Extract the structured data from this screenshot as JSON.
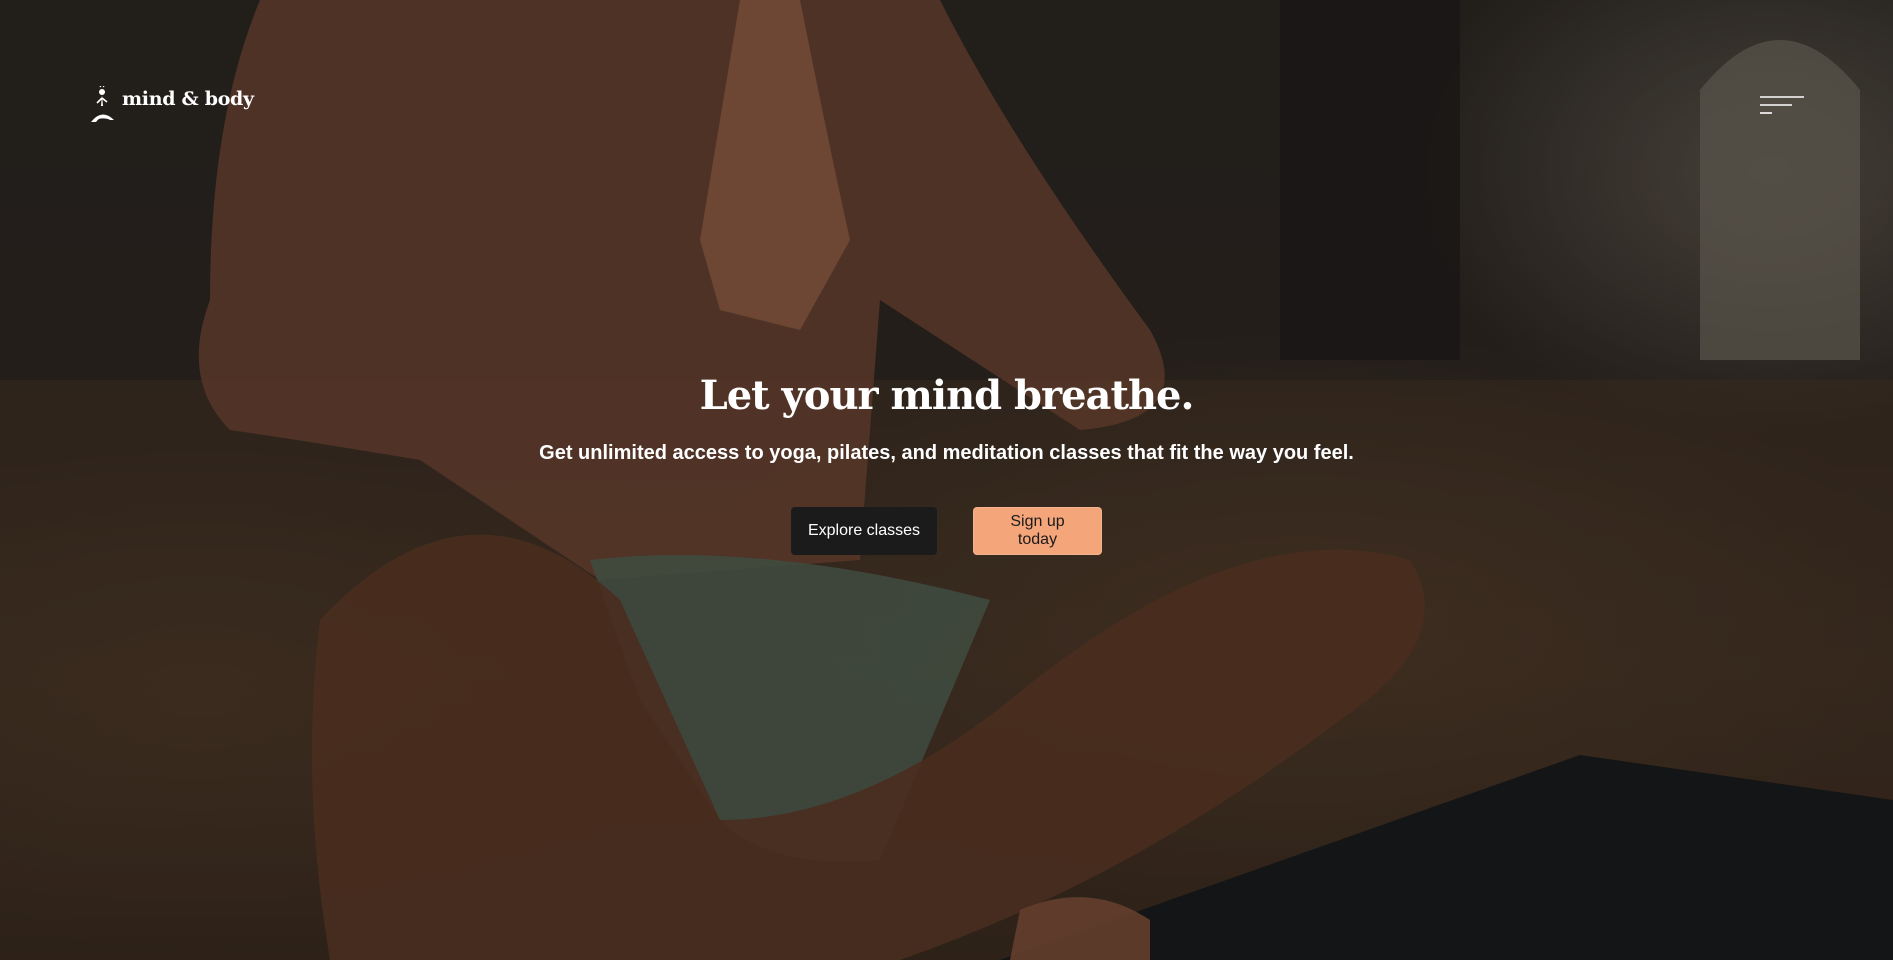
{
  "brand": {
    "logo_text": "mind & body",
    "logo_icon": "meditating-figure-icon"
  },
  "header": {
    "menu_icon": "hamburger-menu-icon"
  },
  "hero": {
    "headline": "Let your mind breathe.",
    "subheadline": "Get unlimited access to yoga, pilates, and meditation classes that fit the way you feel.",
    "background_image": "person-meditating-namaste-photo"
  },
  "actions": {
    "explore_label": "Explore classes",
    "signup_label": "Sign up today"
  },
  "colors": {
    "accent": "#f5a57a",
    "dark_button": "#1b1b1b",
    "text": "#ffffff"
  }
}
